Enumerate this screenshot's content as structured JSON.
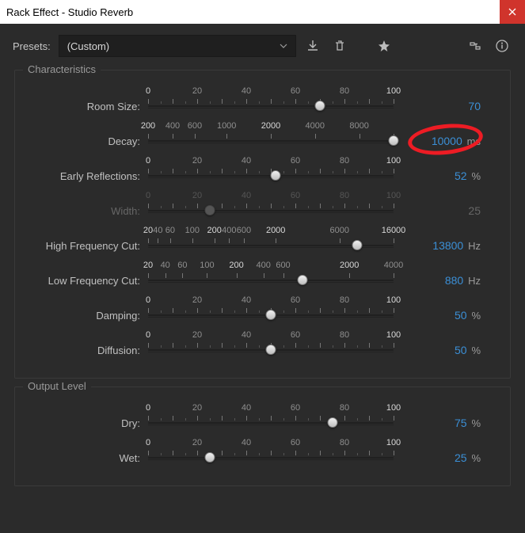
{
  "window": {
    "title": "Rack Effect - Studio Reverb"
  },
  "presets": {
    "label": "Presets:",
    "value": "(Custom)"
  },
  "panels": {
    "characteristics": {
      "title": "Characteristics",
      "rows": [
        {
          "label": "Room Size:",
          "value": "70",
          "unit": "",
          "pos": 70,
          "ticks": [
            {
              "p": 0,
              "l": "0",
              "maj": true,
              "bright": true
            },
            {
              "p": 5
            },
            {
              "p": 10,
              "maj": true
            },
            {
              "p": 15
            },
            {
              "p": 20,
              "l": "20",
              "maj": true,
              "bright": false
            },
            {
              "p": 25
            },
            {
              "p": 30,
              "maj": true
            },
            {
              "p": 35
            },
            {
              "p": 40,
              "l": "40",
              "maj": true,
              "bright": false
            },
            {
              "p": 45
            },
            {
              "p": 50,
              "maj": true
            },
            {
              "p": 55
            },
            {
              "p": 60,
              "l": "60",
              "maj": true,
              "bright": false
            },
            {
              "p": 65
            },
            {
              "p": 70,
              "maj": true
            },
            {
              "p": 75
            },
            {
              "p": 80,
              "l": "80",
              "maj": true,
              "bright": false
            },
            {
              "p": 85
            },
            {
              "p": 90,
              "maj": true
            },
            {
              "p": 95
            },
            {
              "p": 100,
              "l": "100",
              "maj": true,
              "bright": true
            }
          ]
        },
        {
          "label": "Decay:",
          "value": "10000",
          "unit": "ms",
          "pos": 100,
          "highlight": true,
          "ticks": [
            {
              "p": 0,
              "l": "200",
              "maj": true,
              "bright": true
            },
            {
              "p": 10,
              "l": "400",
              "maj": true
            },
            {
              "p": 19,
              "l": "600",
              "maj": true
            },
            {
              "p": 32,
              "l": "1000",
              "maj": true
            },
            {
              "p": 50,
              "l": "2000",
              "maj": true,
              "bright": true
            },
            {
              "p": 68,
              "l": "4000",
              "maj": true
            },
            {
              "p": 86,
              "l": "8000",
              "maj": true
            },
            {
              "p": 100,
              "maj": true,
              "bright": true
            }
          ]
        },
        {
          "label": "Early Reflections:",
          "value": "52",
          "unit": "%",
          "pos": 52,
          "ticks": [
            {
              "p": 0,
              "l": "0",
              "maj": true,
              "bright": true
            },
            {
              "p": 5
            },
            {
              "p": 10,
              "maj": true
            },
            {
              "p": 15
            },
            {
              "p": 20,
              "l": "20",
              "maj": true
            },
            {
              "p": 25
            },
            {
              "p": 30,
              "maj": true
            },
            {
              "p": 35
            },
            {
              "p": 40,
              "l": "40",
              "maj": true
            },
            {
              "p": 45
            },
            {
              "p": 50,
              "maj": true
            },
            {
              "p": 55
            },
            {
              "p": 60,
              "l": "60",
              "maj": true
            },
            {
              "p": 65
            },
            {
              "p": 70,
              "maj": true
            },
            {
              "p": 75
            },
            {
              "p": 80,
              "l": "80",
              "maj": true
            },
            {
              "p": 85
            },
            {
              "p": 90,
              "maj": true
            },
            {
              "p": 95
            },
            {
              "p": 100,
              "l": "100",
              "maj": true,
              "bright": true
            }
          ]
        },
        {
          "label": "Width:",
          "value": "25",
          "unit": "",
          "pos": 25,
          "disabled": true,
          "ticks": [
            {
              "p": 0,
              "l": "0",
              "maj": true
            },
            {
              "p": 5
            },
            {
              "p": 10,
              "maj": true
            },
            {
              "p": 15
            },
            {
              "p": 20,
              "l": "20",
              "maj": true
            },
            {
              "p": 25
            },
            {
              "p": 30,
              "maj": true
            },
            {
              "p": 35
            },
            {
              "p": 40,
              "l": "40",
              "maj": true
            },
            {
              "p": 45
            },
            {
              "p": 50,
              "maj": true
            },
            {
              "p": 55
            },
            {
              "p": 60,
              "l": "60",
              "maj": true
            },
            {
              "p": 65
            },
            {
              "p": 70,
              "maj": true
            },
            {
              "p": 75
            },
            {
              "p": 80,
              "l": "80",
              "maj": true
            },
            {
              "p": 85
            },
            {
              "p": 90,
              "maj": true
            },
            {
              "p": 95
            },
            {
              "p": 100,
              "l": "100",
              "maj": true
            }
          ]
        },
        {
          "label": "High Frequency Cut:",
          "value": "13800",
          "unit": "Hz",
          "pos": 85,
          "ticks": [
            {
              "p": 0,
              "l": "20",
              "maj": true,
              "bright": true
            },
            {
              "p": 4,
              "l": "40",
              "maj": true
            },
            {
              "p": 9,
              "l": "60",
              "maj": true
            },
            {
              "p": 18,
              "l": "100",
              "maj": true
            },
            {
              "p": 27,
              "l": "200",
              "maj": true,
              "bright": true
            },
            {
              "p": 33,
              "l": "400",
              "maj": true
            },
            {
              "p": 39,
              "l": "600",
              "maj": true
            },
            {
              "p": 52,
              "l": "2000",
              "maj": true,
              "bright": true
            },
            {
              "p": 78,
              "l": "6000",
              "maj": true
            },
            {
              "p": 100,
              "l": "16000",
              "maj": true,
              "bright": true
            }
          ]
        },
        {
          "label": "Low Frequency Cut:",
          "value": "880",
          "unit": "Hz",
          "pos": 63,
          "ticks": [
            {
              "p": 0,
              "l": "20",
              "maj": true,
              "bright": true
            },
            {
              "p": 7,
              "l": "40",
              "maj": true
            },
            {
              "p": 14,
              "l": "60",
              "maj": true
            },
            {
              "p": 24,
              "l": "100",
              "maj": true
            },
            {
              "p": 36,
              "l": "200",
              "maj": true,
              "bright": true
            },
            {
              "p": 47,
              "l": "400",
              "maj": true
            },
            {
              "p": 55,
              "l": "600",
              "maj": true
            },
            {
              "p": 82,
              "l": "2000",
              "maj": true,
              "bright": true
            },
            {
              "p": 100,
              "l": "4000",
              "maj": true
            }
          ]
        },
        {
          "label": "Damping:",
          "value": "50",
          "unit": "%",
          "pos": 50,
          "ticks": [
            {
              "p": 0,
              "l": "0",
              "maj": true,
              "bright": true
            },
            {
              "p": 5
            },
            {
              "p": 10,
              "maj": true
            },
            {
              "p": 15
            },
            {
              "p": 20,
              "l": "20",
              "maj": true
            },
            {
              "p": 25
            },
            {
              "p": 30,
              "maj": true
            },
            {
              "p": 35
            },
            {
              "p": 40,
              "l": "40",
              "maj": true
            },
            {
              "p": 45
            },
            {
              "p": 50,
              "maj": true
            },
            {
              "p": 55
            },
            {
              "p": 60,
              "l": "60",
              "maj": true
            },
            {
              "p": 65
            },
            {
              "p": 70,
              "maj": true
            },
            {
              "p": 75
            },
            {
              "p": 80,
              "l": "80",
              "maj": true
            },
            {
              "p": 85
            },
            {
              "p": 90,
              "maj": true
            },
            {
              "p": 95
            },
            {
              "p": 100,
              "l": "100",
              "maj": true,
              "bright": true
            }
          ]
        },
        {
          "label": "Diffusion:",
          "value": "50",
          "unit": "%",
          "pos": 50,
          "ticks": [
            {
              "p": 0,
              "l": "0",
              "maj": true,
              "bright": true
            },
            {
              "p": 5
            },
            {
              "p": 10,
              "maj": true
            },
            {
              "p": 15
            },
            {
              "p": 20,
              "l": "20",
              "maj": true
            },
            {
              "p": 25
            },
            {
              "p": 30,
              "maj": true
            },
            {
              "p": 35
            },
            {
              "p": 40,
              "l": "40",
              "maj": true
            },
            {
              "p": 45
            },
            {
              "p": 50,
              "maj": true
            },
            {
              "p": 55
            },
            {
              "p": 60,
              "l": "60",
              "maj": true
            },
            {
              "p": 65
            },
            {
              "p": 70,
              "maj": true
            },
            {
              "p": 75
            },
            {
              "p": 80,
              "l": "80",
              "maj": true
            },
            {
              "p": 85
            },
            {
              "p": 90,
              "maj": true
            },
            {
              "p": 95
            },
            {
              "p": 100,
              "l": "100",
              "maj": true,
              "bright": true
            }
          ]
        }
      ]
    },
    "output": {
      "title": "Output Level",
      "rows": [
        {
          "label": "Dry:",
          "value": "75",
          "unit": "%",
          "pos": 75,
          "ticks": [
            {
              "p": 0,
              "l": "0",
              "maj": true,
              "bright": true
            },
            {
              "p": 5
            },
            {
              "p": 10,
              "maj": true
            },
            {
              "p": 15
            },
            {
              "p": 20,
              "l": "20",
              "maj": true
            },
            {
              "p": 25
            },
            {
              "p": 30,
              "maj": true
            },
            {
              "p": 35
            },
            {
              "p": 40,
              "l": "40",
              "maj": true
            },
            {
              "p": 45
            },
            {
              "p": 50,
              "maj": true
            },
            {
              "p": 55
            },
            {
              "p": 60,
              "l": "60",
              "maj": true
            },
            {
              "p": 65
            },
            {
              "p": 70,
              "maj": true
            },
            {
              "p": 75
            },
            {
              "p": 80,
              "l": "80",
              "maj": true
            },
            {
              "p": 85
            },
            {
              "p": 90,
              "maj": true
            },
            {
              "p": 95
            },
            {
              "p": 100,
              "l": "100",
              "maj": true,
              "bright": true
            }
          ]
        },
        {
          "label": "Wet:",
          "value": "25",
          "unit": "%",
          "pos": 25,
          "ticks": [
            {
              "p": 0,
              "l": "0",
              "maj": true,
              "bright": true
            },
            {
              "p": 5
            },
            {
              "p": 10,
              "maj": true
            },
            {
              "p": 15
            },
            {
              "p": 20,
              "l": "20",
              "maj": true
            },
            {
              "p": 25
            },
            {
              "p": 30,
              "maj": true
            },
            {
              "p": 35
            },
            {
              "p": 40,
              "l": "40",
              "maj": true
            },
            {
              "p": 45
            },
            {
              "p": 50,
              "maj": true
            },
            {
              "p": 55
            },
            {
              "p": 60,
              "l": "60",
              "maj": true
            },
            {
              "p": 65
            },
            {
              "p": 70,
              "maj": true
            },
            {
              "p": 75
            },
            {
              "p": 80,
              "l": "80",
              "maj": true
            },
            {
              "p": 85
            },
            {
              "p": 90,
              "maj": true
            },
            {
              "p": 95
            },
            {
              "p": 100,
              "l": "100",
              "maj": true,
              "bright": true
            }
          ]
        }
      ]
    }
  }
}
